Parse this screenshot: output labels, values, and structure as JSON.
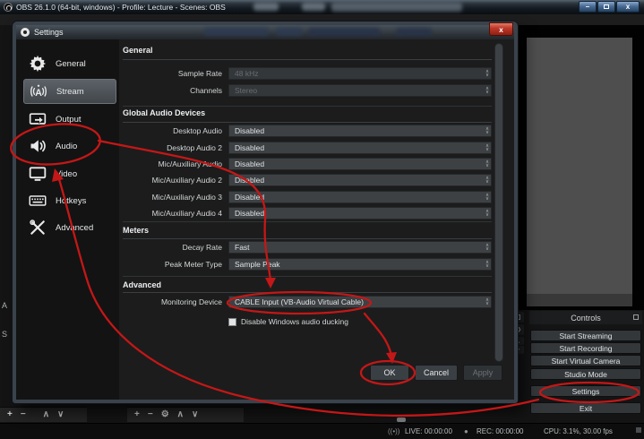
{
  "colors": {
    "annotation_red": "#c41717",
    "selection_gray": "#5c6268",
    "dialog_bg": "#1c1c1c",
    "field_bg": "#3d4144"
  },
  "icons": {
    "spin_up": "∧",
    "spin_down": "∨",
    "gear": "⚙",
    "plus": "+",
    "minus": "−",
    "up": "∧",
    "down": "∨",
    "live": "((•))",
    "rec_dot": "●",
    "minimize": "–",
    "close": "x"
  },
  "main_window": {
    "title": "OBS 26.1.0 (64-bit, windows) - Profile: Lecture - Scenes: OBS",
    "partial_panel_letters": {
      "audio_mixer": "A",
      "sources": "S"
    }
  },
  "status_bar": {
    "live": "LIVE: 00:00:00",
    "rec": "REC: 00:00:00",
    "cpu": "CPU: 3.1%, 30.00 fps"
  },
  "controls_panel": {
    "header": "Controls",
    "buttons": [
      {
        "label": "Start Streaming"
      },
      {
        "label": "Start Recording"
      },
      {
        "label": "Start Virtual Camera"
      },
      {
        "label": "Studio Mode"
      },
      {
        "label": "Settings",
        "annotated": true
      },
      {
        "label": "Exit"
      }
    ]
  },
  "scenes_toolbar": [
    "+",
    "−",
    "∧",
    "∨"
  ],
  "sources_toolbar": [
    "+",
    "−",
    "⚙",
    "∧",
    "∨"
  ],
  "dialog": {
    "title": "Settings",
    "sidebar": [
      {
        "label": "General"
      },
      {
        "label": "Stream",
        "selected": true
      },
      {
        "label": "Output"
      },
      {
        "label": "Audio",
        "annotated": true
      },
      {
        "label": "Video"
      },
      {
        "label": "Hotkeys"
      },
      {
        "label": "Advanced"
      }
    ],
    "sections": {
      "general": {
        "header": "General",
        "rows": [
          {
            "label": "Sample Rate",
            "value": "48 kHz",
            "disabled": true
          },
          {
            "label": "Channels",
            "value": "Stereo",
            "disabled": true
          }
        ]
      },
      "global_audio_devices": {
        "header": "Global Audio Devices",
        "rows": [
          {
            "label": "Desktop Audio",
            "value": "Disabled"
          },
          {
            "label": "Desktop Audio 2",
            "value": "Disabled"
          },
          {
            "label": "Mic/Auxiliary Audio",
            "value": "Disabled"
          },
          {
            "label": "Mic/Auxiliary Audio 2",
            "value": "Disabled"
          },
          {
            "label": "Mic/Auxiliary Audio 3",
            "value": "Disabled"
          },
          {
            "label": "Mic/Auxiliary Audio 4",
            "value": "Disabled"
          }
        ]
      },
      "meters": {
        "header": "Meters",
        "rows": [
          {
            "label": "Decay Rate",
            "value": "Fast"
          },
          {
            "label": "Peak Meter Type",
            "value": "Sample Peak"
          }
        ]
      },
      "advanced": {
        "header": "Advanced",
        "rows": [
          {
            "label": "Monitoring Device",
            "value": "CABLE Input (VB-Audio Virtual Cable)",
            "annotated": true
          }
        ],
        "checkbox": {
          "label": "Disable Windows audio ducking",
          "checked": false
        }
      }
    },
    "footer_buttons": {
      "ok": "OK",
      "cancel": "Cancel",
      "apply": "Apply"
    }
  }
}
